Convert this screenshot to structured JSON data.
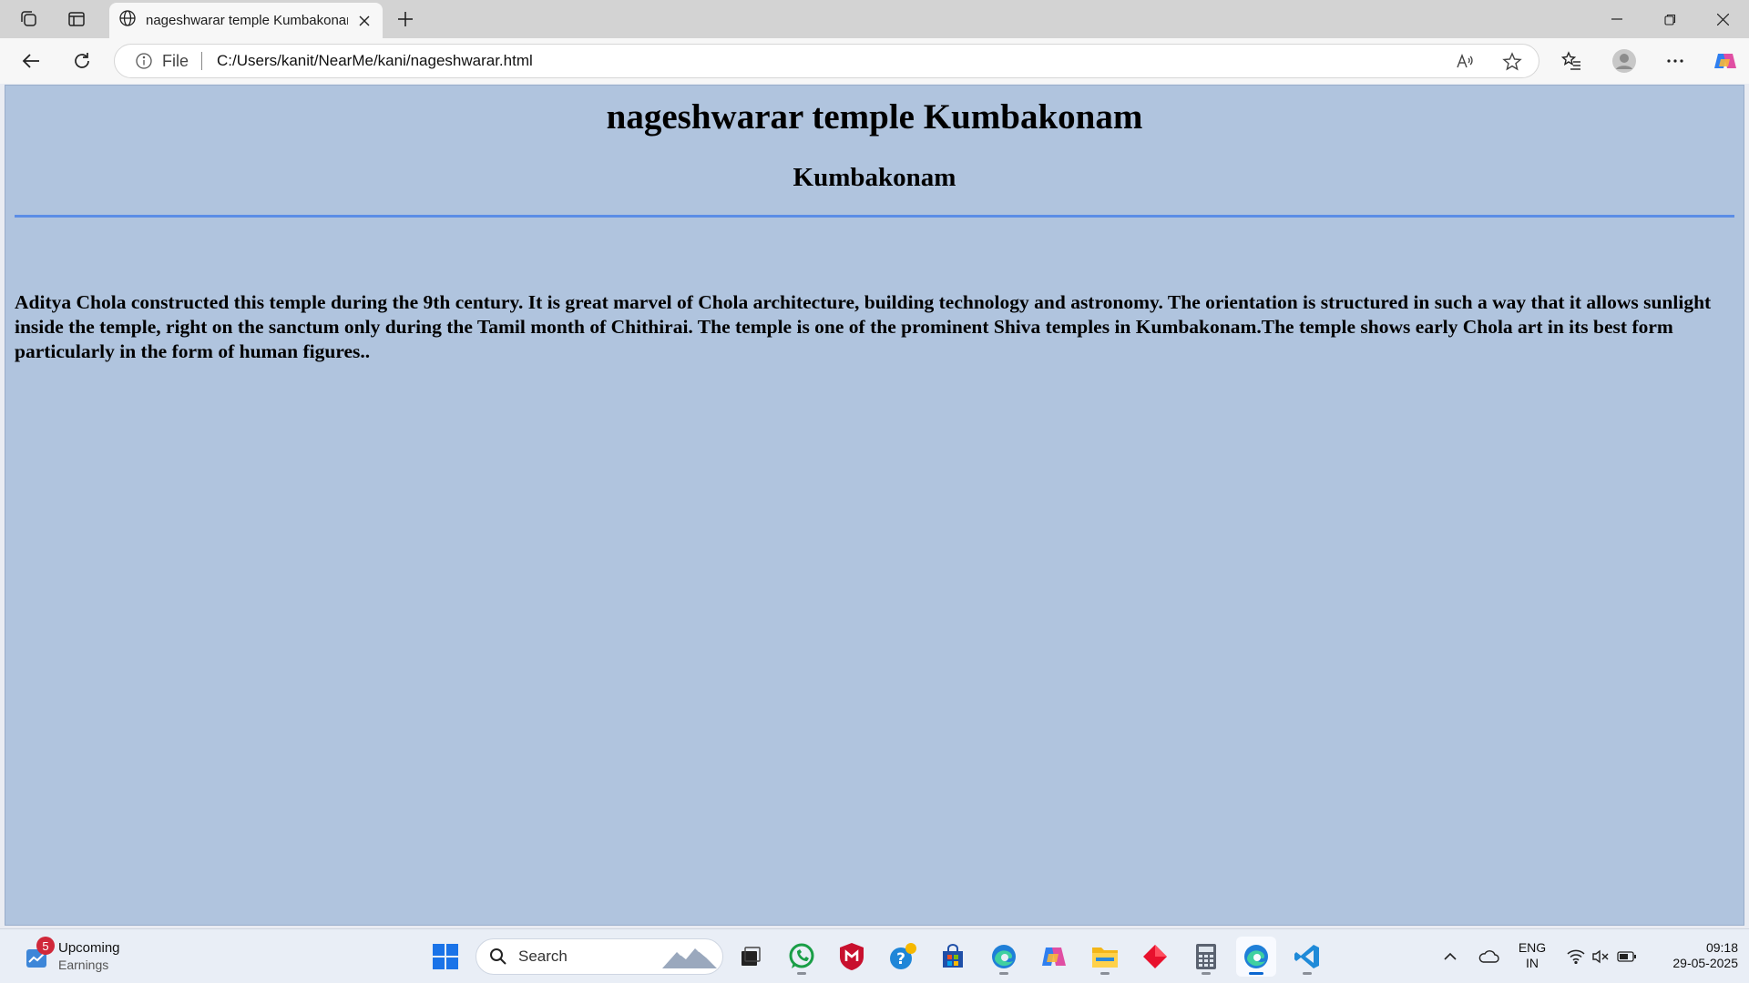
{
  "browser": {
    "tab_title": "nageshwarar temple Kumbakonam",
    "address_scheme": "File",
    "address_url": "C:/Users/kanit/NearMe/kani/nageshwarar.html"
  },
  "page": {
    "heading": "nageshwarar temple Kumbakonam",
    "subheading": "Kumbakonam",
    "paragraph": "Aditya Chola constructed this temple during the 9th century. It is great marvel of Chola architecture, building technology and astronomy. The orientation is structured in such a way that it allows sunlight inside the temple, right on the sanctum only during the Tamil month of Chithirai. The temple is one of the prominent Shiva temples in Kumbakonam.The temple shows early Chola art in its best form particularly in the form of human figures..",
    "background_color": "#b0c4de",
    "rule_color": "#5b8de6"
  },
  "taskbar": {
    "widget_title": "Upcoming",
    "widget_subtitle": "Earnings",
    "widget_badge": "5",
    "search_placeholder": "Search",
    "language": "ENG",
    "region": "IN",
    "time": "09:18",
    "date": "29-05-2025"
  }
}
